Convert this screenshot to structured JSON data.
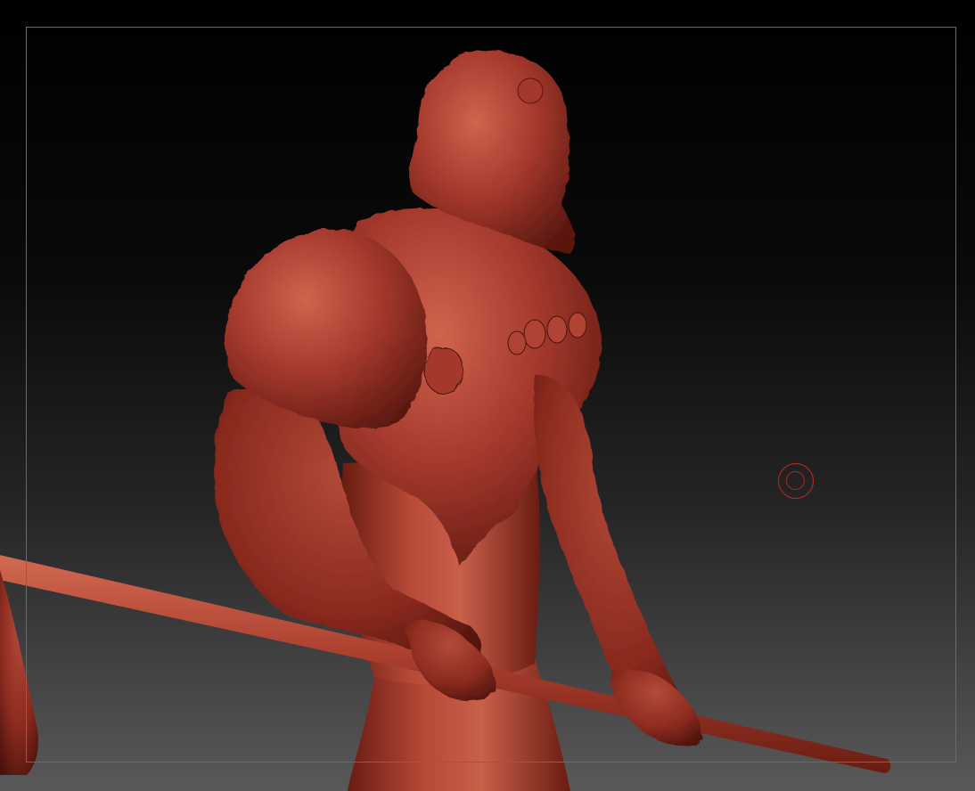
{
  "canvas": {
    "background_top": "#000000",
    "background_bottom": "#595959"
  },
  "frame": {
    "border_color": "#6a6a6a"
  },
  "model": {
    "name_icon": "sculpt-figure-icon",
    "material_base": "#a4382c",
    "material_highlight": "#d0644e",
    "material_shadow": "#4a120c"
  },
  "brush": {
    "icon": "brush-circle-icon",
    "color": "#c02a2a"
  }
}
